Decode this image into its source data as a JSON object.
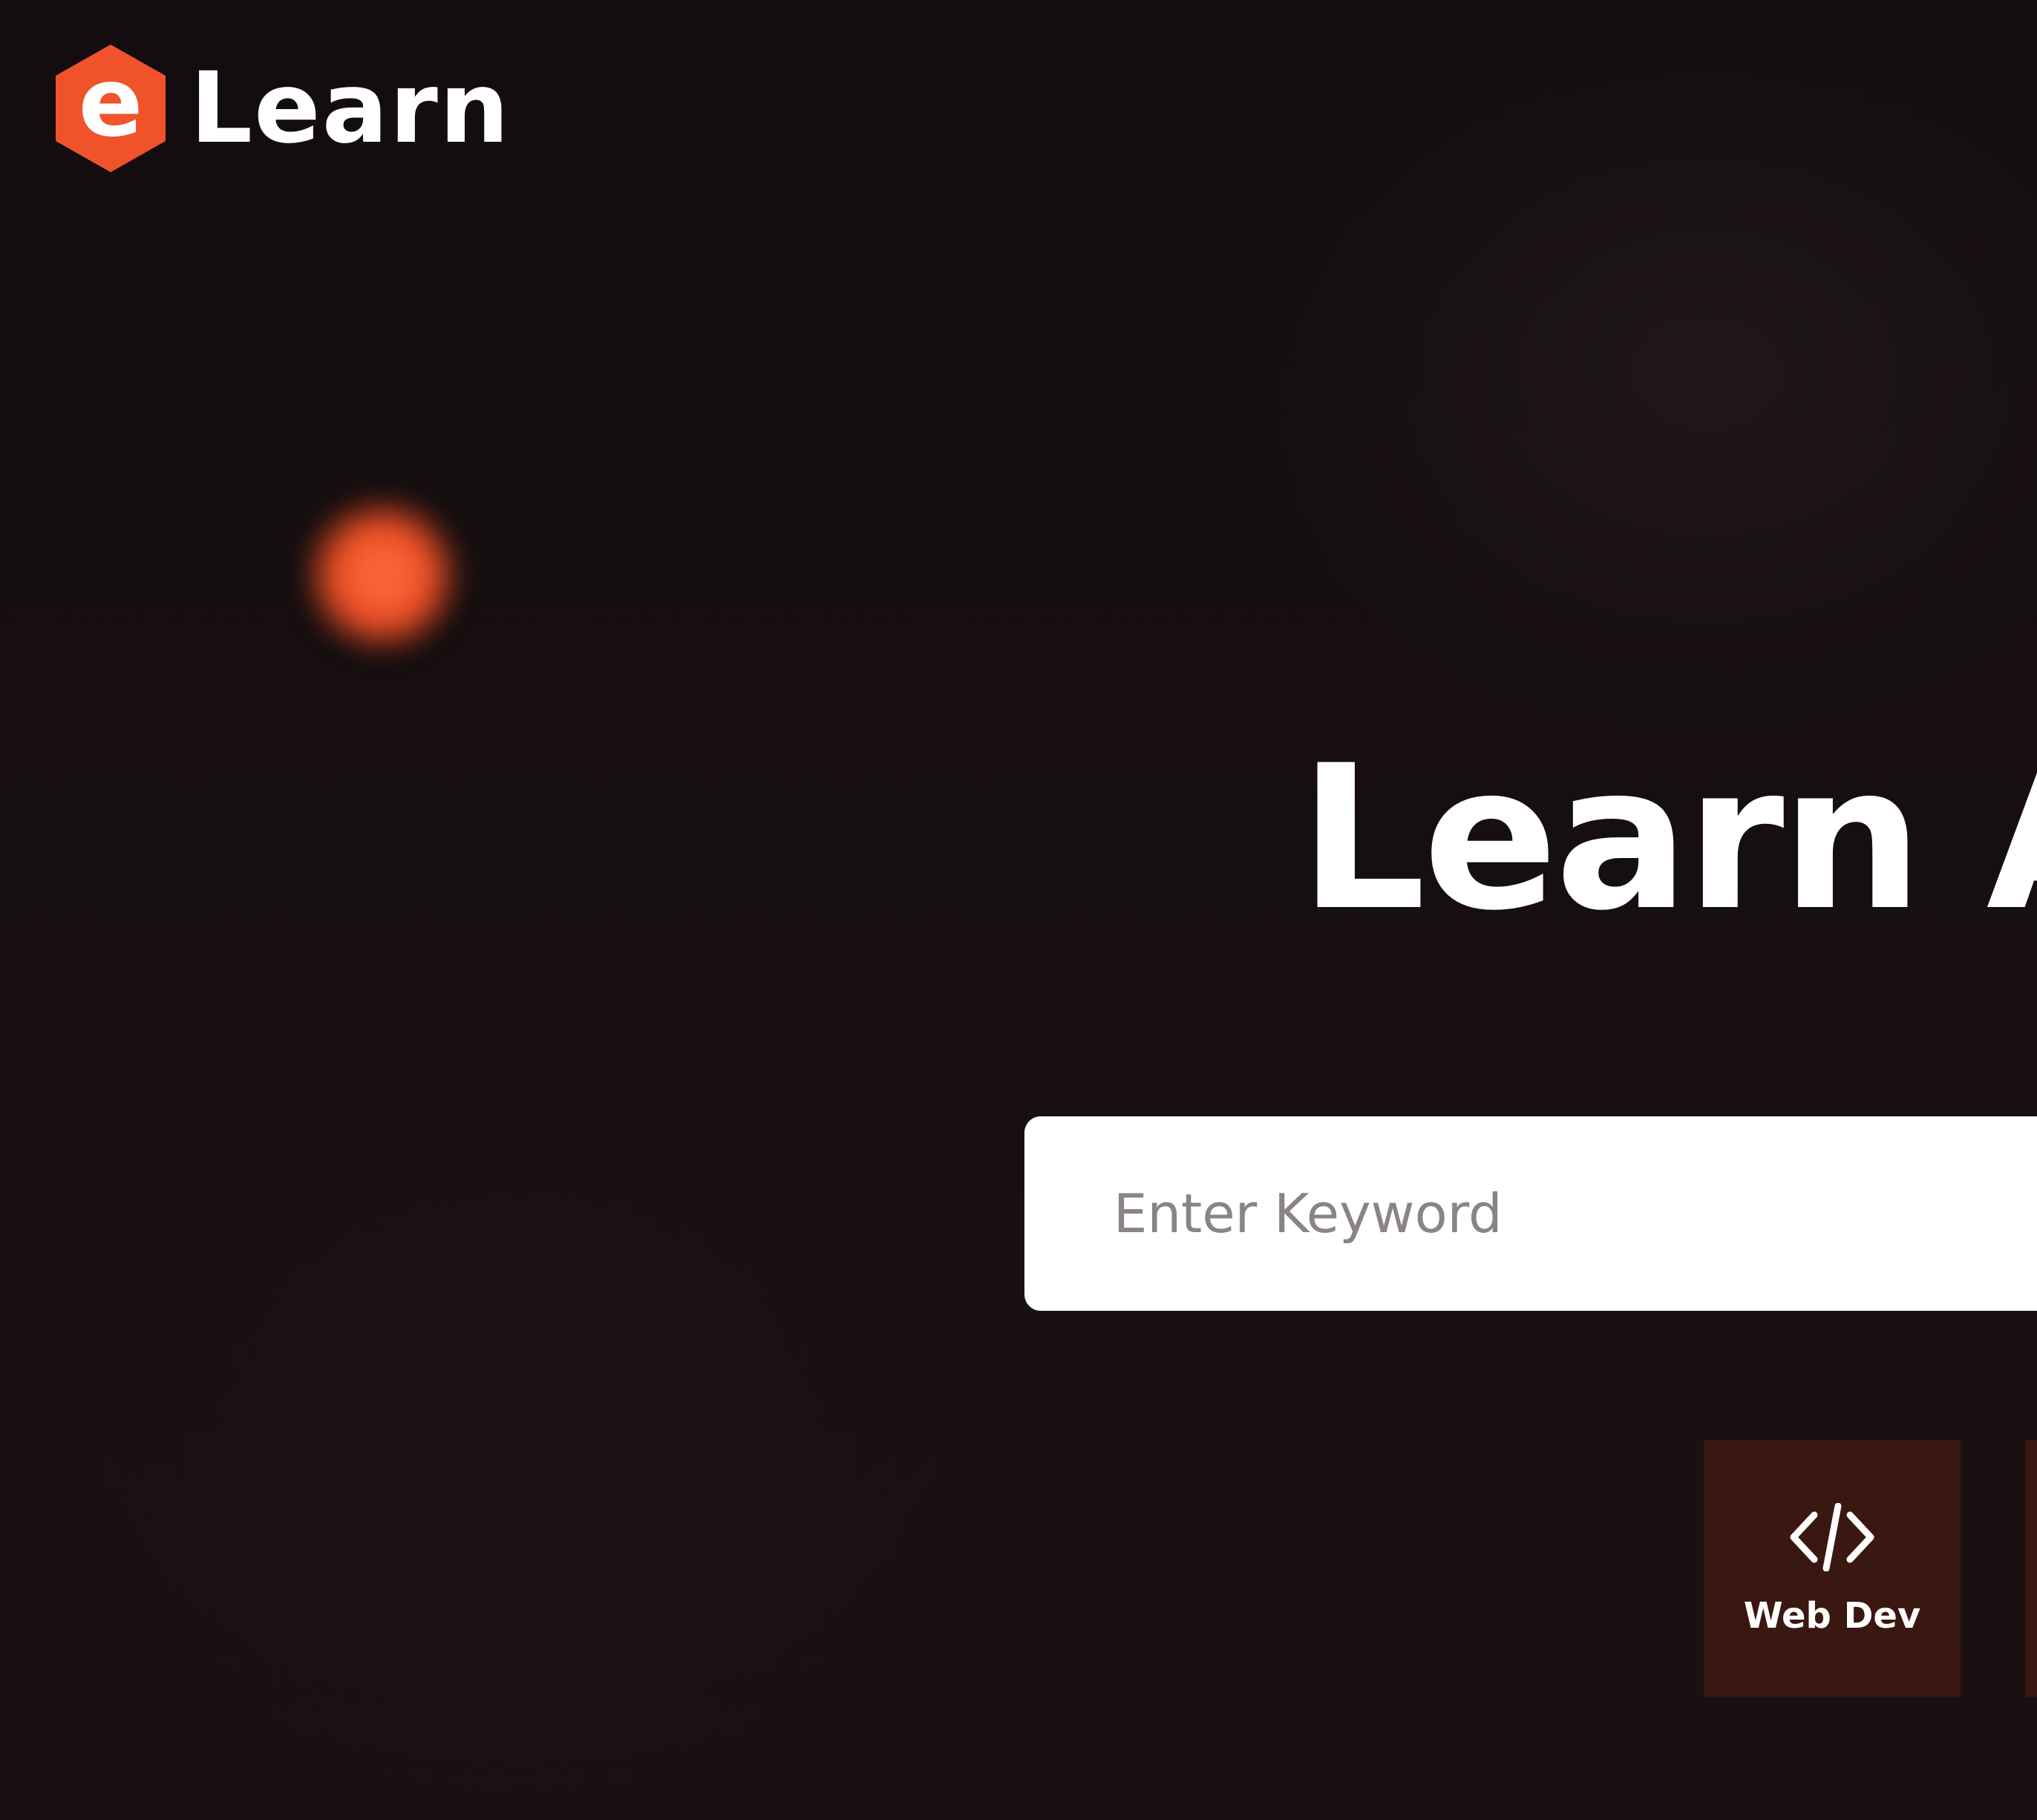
{
  "brand": {
    "logo_letter": "e",
    "name": "Learn",
    "accent_color": "#f0532a"
  },
  "hero": {
    "title": "Learn A"
  },
  "search": {
    "placeholder": "Enter Keyword"
  },
  "categories": [
    {
      "label": "Web Dev",
      "icon": "code-icon",
      "background": "#3b1711"
    }
  ]
}
